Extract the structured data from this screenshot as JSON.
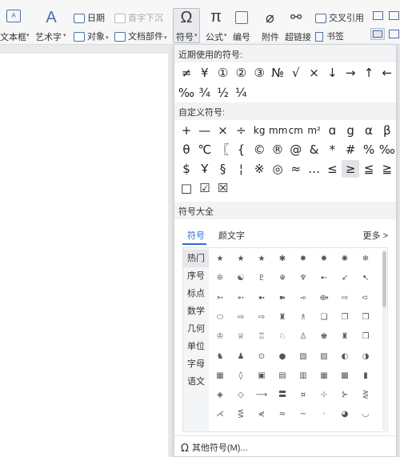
{
  "ribbon": {
    "textbox_label": "文本框",
    "wordart_label": "艺术字",
    "date_label": "日期",
    "object_label": "对象",
    "dropcap_label": "首字下沉",
    "docpart_label": "文档部件",
    "symbol_label": "符号",
    "formula_label": "公式",
    "number_label": "编号",
    "attachment_label": "附件",
    "hyperlink_label": "超链接",
    "crossref_label": "交叉引用",
    "bookmark_label": "书签",
    "formula_glyph": "π",
    "symbol_glyph": "Ω",
    "wordart_glyph": "A"
  },
  "panel": {
    "recent_title": "近期使用的符号:",
    "recent_symbols": [
      "≠",
      "¥",
      "①",
      "②",
      "③",
      "№",
      "√",
      "×",
      "↓",
      "→",
      "↑",
      "←",
      "‰",
      "¾",
      "½",
      "¼"
    ],
    "custom_title": "自定义符号:",
    "custom_symbols": [
      "+",
      "—",
      "×",
      "÷",
      "kg",
      "mm",
      "cm",
      "m²",
      "ɑ",
      "g",
      "α",
      "β",
      "θ",
      "℃",
      "〖",
      "{",
      "©",
      "®",
      "@",
      "&",
      "*",
      "#",
      "%",
      "‰",
      "$",
      "Ұ",
      "§",
      "¦",
      "※",
      "◎",
      "≈",
      "…",
      "≤",
      "≥",
      "≦",
      "≧",
      "□",
      "☑",
      "☒"
    ],
    "selected_custom_index": 33,
    "all_title": "符号大全",
    "tabs": [
      "符号",
      "颜文字"
    ],
    "active_tab": 0,
    "more_label": "更多 >",
    "categories": [
      "热门",
      "序号",
      "标点",
      "数学",
      "几何",
      "单位",
      "字母",
      "语文"
    ],
    "active_category": 0,
    "grid_symbols": [
      "★",
      "★",
      "★",
      "✱",
      "✸",
      "✹",
      "✺",
      "❄",
      "❊",
      "☯",
      "♇",
      "☬",
      "♆",
      "➸",
      "➶",
      "➷",
      "➳",
      "➵",
      "➼",
      "➽",
      "➾",
      "⟴",
      "⇨",
      "➪",
      "⬭",
      "⇨",
      "⇨",
      "♜",
      "♗",
      "❏",
      "❐",
      "❒",
      "♔",
      "♕",
      "♖",
      "♘",
      "♙",
      "♚",
      "♜",
      "❐",
      "♞",
      "♟",
      "⊙",
      "●",
      "▧",
      "▨",
      "◐",
      "◑",
      "▦",
      "◊",
      "▣",
      "▤",
      "▥",
      "▦",
      "▩",
      "▮",
      "◈",
      "◇",
      "⟶",
      "〓",
      "¤",
      "⊹",
      "⊱",
      "⋛",
      "⋌",
      "⋚",
      "⋞",
      "≈",
      "∼",
      "·",
      "◕",
      "◡"
    ],
    "footer_label": "其他符号(M)...",
    "footer_glyph": "Ω"
  }
}
